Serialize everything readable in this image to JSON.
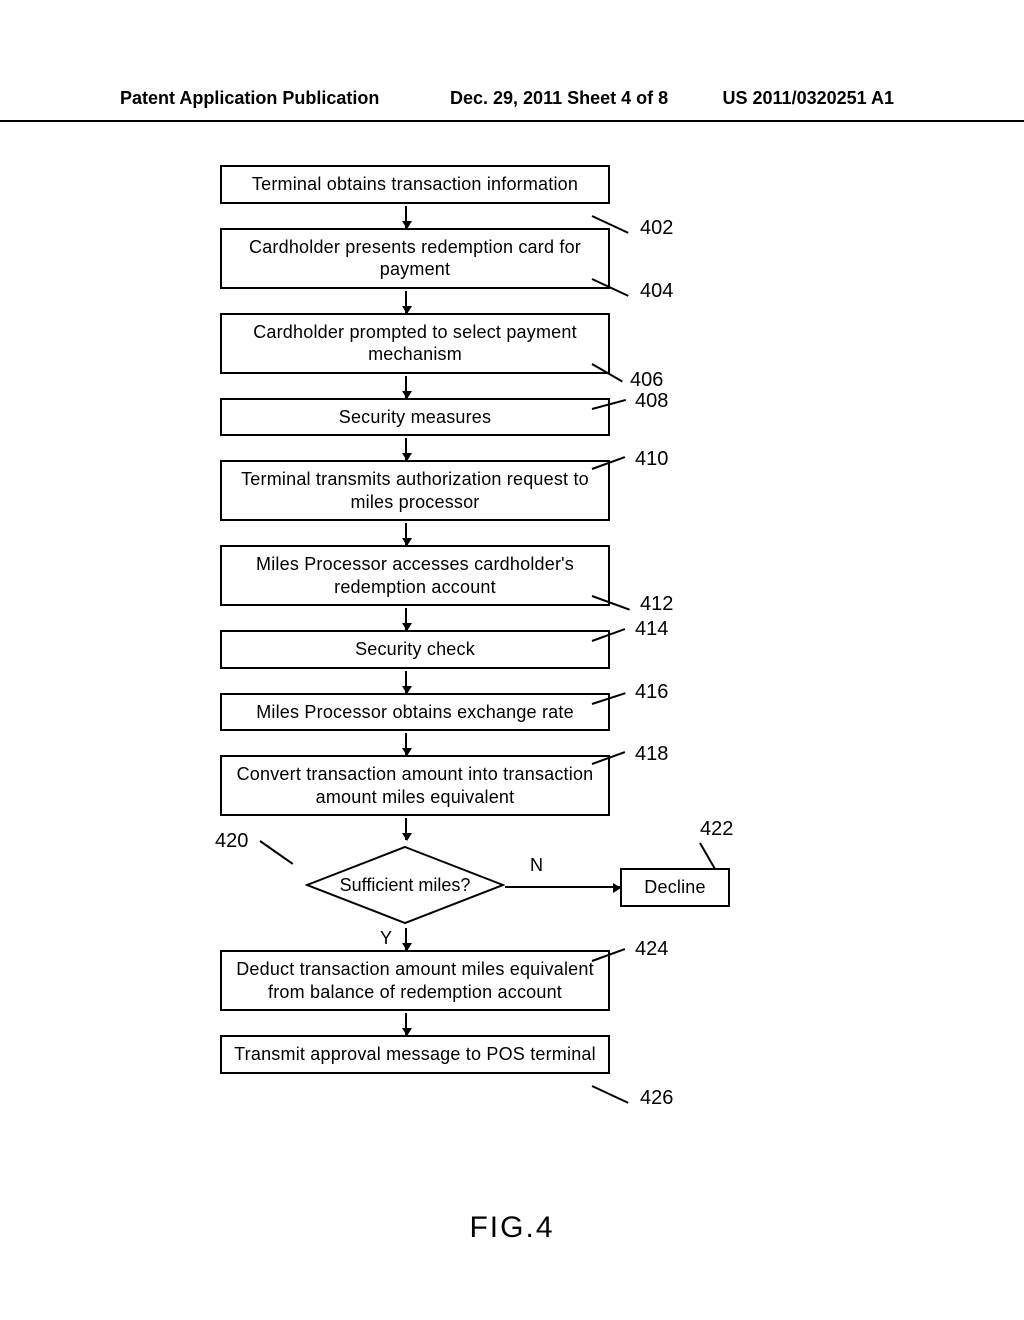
{
  "header": {
    "left": "Patent Application Publication",
    "mid": "Dec. 29, 2011  Sheet 4 of 8",
    "right": "US 2011/0320251 A1"
  },
  "chart_data": {
    "type": "flowchart",
    "title": "FIG.4",
    "nodes": [
      {
        "id": "402",
        "shape": "process",
        "text": "Terminal obtains transaction information"
      },
      {
        "id": "404",
        "shape": "process",
        "text": "Cardholder presents redemption card for payment"
      },
      {
        "id": "406",
        "shape": "process",
        "text": "Cardholder prompted to select payment mechanism"
      },
      {
        "id": "408",
        "shape": "process",
        "text": "Security measures"
      },
      {
        "id": "410",
        "shape": "process",
        "text": "Terminal transmits authorization request to miles processor"
      },
      {
        "id": "412",
        "shape": "process",
        "text": "Miles Processor accesses cardholder's redemption account"
      },
      {
        "id": "414",
        "shape": "process",
        "text": "Security check"
      },
      {
        "id": "416",
        "shape": "process",
        "text": "Miles Processor obtains exchange rate"
      },
      {
        "id": "418",
        "shape": "process",
        "text": "Convert transaction amount into transaction amount miles equivalent"
      },
      {
        "id": "420",
        "shape": "decision",
        "text": "Sufficient miles?"
      },
      {
        "id": "422",
        "shape": "process",
        "text": "Decline"
      },
      {
        "id": "424",
        "shape": "process",
        "text": "Deduct transaction amount miles equivalent from balance of redemption account"
      },
      {
        "id": "426",
        "shape": "process",
        "text": "Transmit approval message to POS terminal"
      }
    ],
    "edges": [
      {
        "from": "402",
        "to": "404"
      },
      {
        "from": "404",
        "to": "406"
      },
      {
        "from": "406",
        "to": "408"
      },
      {
        "from": "408",
        "to": "410"
      },
      {
        "from": "410",
        "to": "412"
      },
      {
        "from": "412",
        "to": "414"
      },
      {
        "from": "414",
        "to": "416"
      },
      {
        "from": "416",
        "to": "418"
      },
      {
        "from": "418",
        "to": "420"
      },
      {
        "from": "420",
        "to": "422",
        "label": "N"
      },
      {
        "from": "420",
        "to": "424",
        "label": "Y"
      },
      {
        "from": "424",
        "to": "426"
      }
    ]
  },
  "labels": {
    "n402": "402",
    "n404": "404",
    "n406": "406",
    "n408": "408",
    "n410": "410",
    "n412": "412",
    "n414": "414",
    "n416": "416",
    "n418": "418",
    "n420": "420",
    "n422": "422",
    "n424": "424",
    "n426": "426",
    "decision_no": "N",
    "decision_yes": "Y"
  }
}
